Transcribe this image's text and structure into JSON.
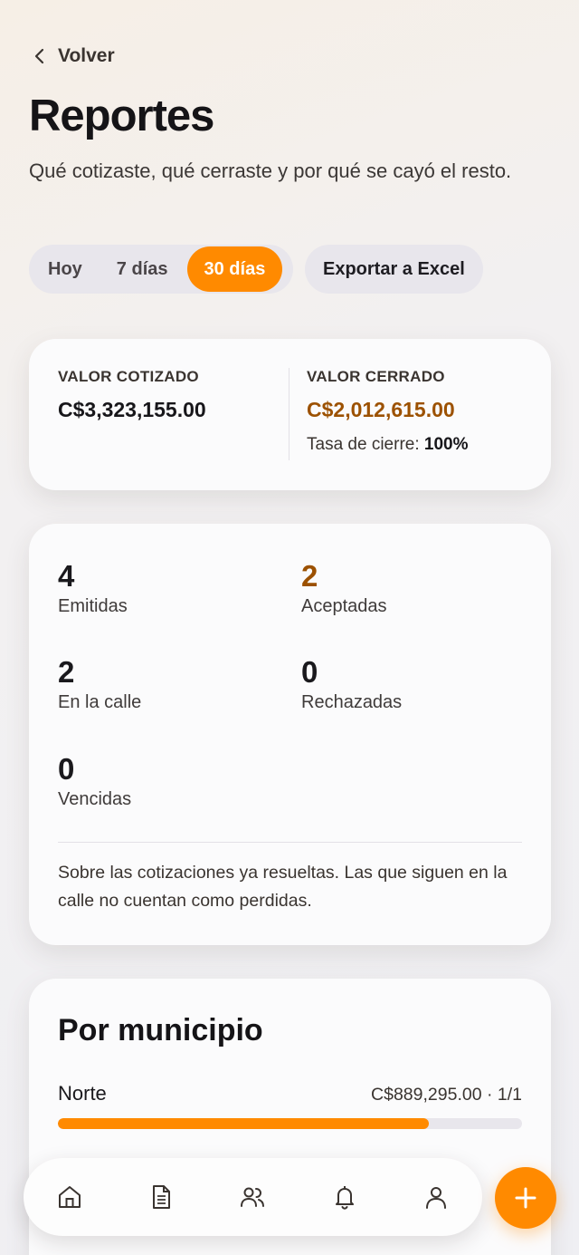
{
  "nav": {
    "back_label": "Volver"
  },
  "page": {
    "title": "Reportes",
    "subtitle": "Qué cotizaste, qué cerraste y por qué se cayó el resto."
  },
  "range": {
    "options": [
      "Hoy",
      "7 días",
      "30 días"
    ],
    "selected": "30 días"
  },
  "export_label": "Exportar a Excel",
  "values": {
    "quoted_label": "VALOR COTIZADO",
    "quoted_amount": "C$3,323,155.00",
    "closed_label": "VALOR CERRADO",
    "closed_amount": "C$2,012,615.00",
    "close_rate_label": "Tasa de cierre:",
    "close_rate_value": "100%"
  },
  "stats": {
    "issued": {
      "value": "4",
      "label": "Emitidas"
    },
    "accepted": {
      "value": "2",
      "label": "Aceptadas"
    },
    "outstanding": {
      "value": "2",
      "label": "En la calle"
    },
    "rejected": {
      "value": "0",
      "label": "Rechazadas"
    },
    "expired": {
      "value": "0",
      "label": "Vencidas"
    },
    "note": "Sobre las cotizaciones ya resueltas. Las que siguen en la calle no cuentan como perdidas."
  },
  "municipalities": {
    "title": "Por municipio",
    "rows": [
      {
        "name": "Norte",
        "value": "C$889,295.00 · 1/1",
        "fraction": 0.8
      }
    ]
  },
  "colors": {
    "accent": "#ff8a00",
    "accent_text": "#9c5100"
  },
  "bottom_nav": {
    "items": [
      "home-icon",
      "document-icon",
      "users-icon",
      "bell-icon",
      "user-icon"
    ],
    "fab_icon": "plus-icon"
  }
}
